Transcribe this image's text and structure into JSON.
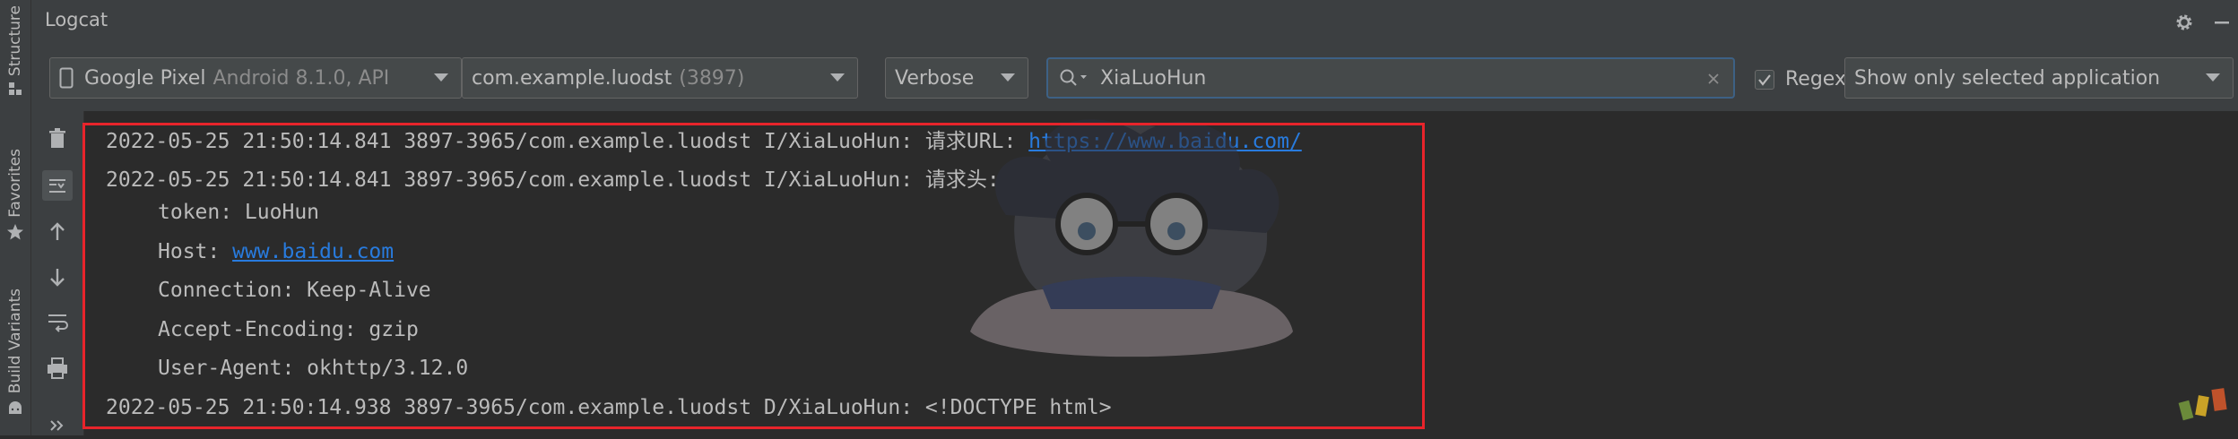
{
  "side_tabs": [
    {
      "label": "Structure",
      "icon": "structure-icon"
    },
    {
      "label": "Favorites",
      "icon": "star-icon"
    },
    {
      "label": "Build Variants",
      "icon": "android-icon"
    }
  ],
  "window": {
    "title": "Logcat"
  },
  "toolbar": {
    "device": {
      "name": "Google Pixel",
      "detail": "Android 8.1.0, API"
    },
    "process": {
      "name": "com.example.luodst",
      "pid": "(3897)"
    },
    "log_level": "Verbose",
    "search": {
      "value": "XiaLuoHun"
    },
    "regex": {
      "label": "Regex",
      "checked": true
    },
    "filter_mode": "Show only selected application"
  },
  "log": {
    "lines": [
      {
        "prefix": "2022-05-25 21:50:14.841 3897-3965/com.example.luodst I/XiaLuoHun: 请求URL: ",
        "link": "https://www.baidu.com/"
      },
      {
        "prefix": "2022-05-25 21:50:14.841 3897-3965/com.example.luodst I/XiaLuoHun: 请求头:"
      },
      {
        "prefix": "token: LuoHun"
      },
      {
        "prefix": "Host: ",
        "link": "www.baidu.com"
      },
      {
        "prefix": "Connection: Keep-Alive"
      },
      {
        "prefix": "Accept-Encoding: gzip"
      },
      {
        "prefix": "User-Agent: okhttp/3.12.0"
      },
      {
        "prefix": "2022-05-25 21:50:14.938 3897-3965/com.example.luodst D/XiaLuoHun: <!DOCTYPE html>"
      }
    ]
  },
  "colors": {
    "highlight": "#e8242b",
    "link": "#287bde",
    "accent_focus": "#3d6185"
  }
}
